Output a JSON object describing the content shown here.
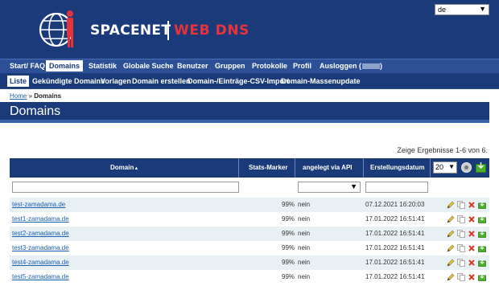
{
  "header": {
    "logo_text": "SPACENET",
    "logo_accent": "WEB DNS",
    "language": "de",
    "colors": {
      "brand": "#1b3a7a",
      "accent": "#e8333a"
    }
  },
  "nav": {
    "primary": [
      {
        "label": "Start/ FAQ"
      },
      {
        "label": "Domains",
        "active": true
      },
      {
        "label": "Statistik"
      },
      {
        "label": "Globale Suche"
      },
      {
        "label": "Benutzer"
      },
      {
        "label": "Gruppen"
      },
      {
        "label": "Protokolle"
      },
      {
        "label": "Profil"
      },
      {
        "label": "Ausloggen ("
      }
    ],
    "logout_close": ")",
    "secondary": [
      {
        "label": "Liste",
        "active": true
      },
      {
        "label": "Gekündigte Domains"
      },
      {
        "label": "Vorlagen"
      },
      {
        "label": "Domain erstellen"
      },
      {
        "label": "Domain-/Einträge-CSV-Import"
      },
      {
        "label": "Domain-Massenupdate"
      }
    ]
  },
  "breadcrumb": {
    "home": "Home",
    "sep": "»",
    "current": "Domains"
  },
  "page_title": "Domains",
  "results_text": "Zeige Ergebnisse 1-6 von 6.",
  "table": {
    "columns": [
      "Domain",
      "Stats-Marker",
      "angelegt via API",
      "Erstellungsdatum"
    ],
    "sort_indicator": "▲",
    "page_size": "20",
    "rows": [
      {
        "domain": "test-zamadama.de",
        "stats": "99%",
        "api": "nein",
        "created": "07.12.2021 16:20:03"
      },
      {
        "domain": "test1-zamadama.de",
        "stats": "99%",
        "api": "nein",
        "created": "17.01.2022 16:51:41"
      },
      {
        "domain": "test2-zamadama.de",
        "stats": "99%",
        "api": "nein",
        "created": "17.01.2022 16:51:41"
      },
      {
        "domain": "test3-zamadama.de",
        "stats": "99%",
        "api": "nein",
        "created": "17.01.2022 16:51:41"
      },
      {
        "domain": "test4-zamadama.de",
        "stats": "99%",
        "api": "nein",
        "created": "17.01.2022 16:51:41"
      },
      {
        "domain": "test5-zamadama.de",
        "stats": "99%",
        "api": "nein",
        "created": "17.01.2022 16:51:41"
      }
    ],
    "row_actions": [
      "edit-icon",
      "copy-icon",
      "delete-icon",
      "export-icon"
    ]
  }
}
